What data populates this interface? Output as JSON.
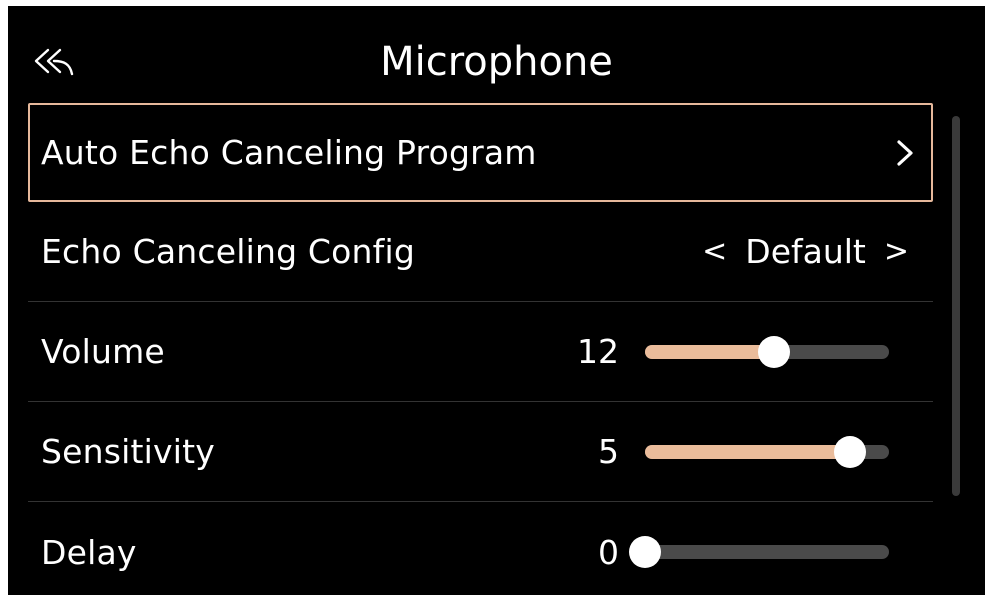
{
  "header": {
    "title": "Microphone",
    "back_icon": "back-arrow-icon"
  },
  "items": [
    {
      "label": "Auto Echo Canceling Program",
      "type": "link",
      "icon": "chevron-right-icon",
      "selected": true
    },
    {
      "label": "Echo Canceling Config",
      "type": "select",
      "prev": "<",
      "value": "Default",
      "next": ">"
    },
    {
      "label": "Volume",
      "type": "slider",
      "value": "12",
      "fill_fraction": 0.53
    },
    {
      "label": "Sensitivity",
      "type": "slider",
      "value": "5",
      "fill_fraction": 0.84
    },
    {
      "label": "Delay",
      "type": "slider",
      "value": "0",
      "fill_fraction": 0.0
    }
  ],
  "colors": {
    "background": "#000000",
    "accent": "#eabc9b",
    "selection_border": "#e6b89b",
    "track": "#4a4a4a",
    "text": "#ffffff"
  }
}
